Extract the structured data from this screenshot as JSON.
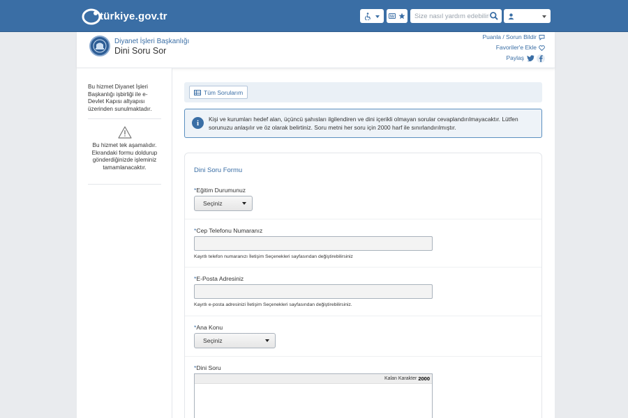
{
  "header": {
    "logo_text": "türkiye.gov.tr",
    "search_placeholder": "Size nasıl yardım edebilirim?"
  },
  "service": {
    "org_name": "Diyanet İşleri Başkanlığı",
    "title": "Dini Soru Sor",
    "links": {
      "rate": "Puanla / Sorun Bildir",
      "favorite": "Favoriler'e Ekle",
      "share": "Paylaş"
    }
  },
  "sidebar": {
    "note": "Bu hizmet Diyanet İşleri Başkanlığı işbirliği ile e-Devlet Kapısı altyapısı üzerinden sunulmaktadır.",
    "step_note": "Bu hizmet tek aşamalıdır. Ekrandaki formu doldurup gönderdiğinizde işleminiz tamamlanacaktır."
  },
  "toolbar": {
    "all_questions": "Tüm Sorularım"
  },
  "info": {
    "text": "Kişi ve kurumları hedef alan, üçüncü şahısları ilgilendiren ve dini içerikli olmayan sorular cevaplandırılmayacaktır. Lütfen sorunuzu anlaşılır ve öz olarak belirtiniz. Soru metni her soru için 2000 harf ile sınırlandırılmıştır."
  },
  "form": {
    "title": "Dini Soru Formu",
    "required_mark": "*",
    "education": {
      "label": "Eğitim Durumunuz",
      "value": "Seçiniz"
    },
    "phone": {
      "label": "Cep Telefonu Numaranız",
      "value": "",
      "hint": "Kayıtlı telefon numaranızı İletişim Seçenekleri sayfasından değiştirebilirsiniz"
    },
    "email": {
      "label": "E-Posta Adresiniz",
      "value": "",
      "hint": "Kayıtlı e-posta adresinizi İletişim Seçenekleri sayfasından değiştirebilirsiniz."
    },
    "topic": {
      "label": "Ana Konu",
      "value": "Seçiniz"
    },
    "question": {
      "label": "Dini Soru",
      "remaining_label": "Kalan Karakter",
      "remaining_count": "2000"
    }
  },
  "colors": {
    "primary": "#3a6ea5",
    "header": "#3a6ea5",
    "border": "#a9b2bc"
  },
  "icons": [
    "logo-icon",
    "accessibility-icon",
    "keyboard-icon",
    "star-icon",
    "search-icon",
    "user-icon",
    "chevron-down-icon",
    "comment-icon",
    "heart-icon",
    "twitter-icon",
    "facebook-icon",
    "warning-icon",
    "table-icon",
    "info-icon"
  ]
}
